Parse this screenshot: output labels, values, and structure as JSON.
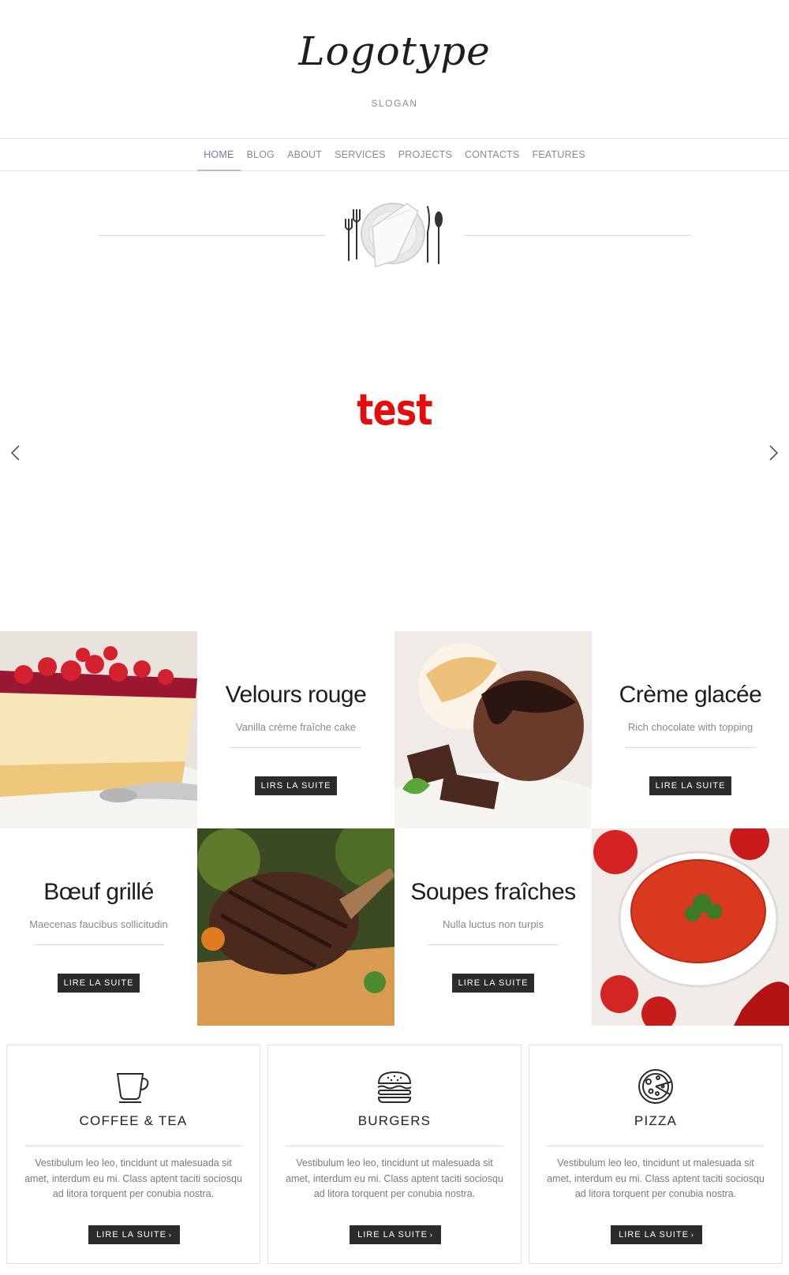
{
  "header": {
    "logo": "Logotype",
    "slogan": "SLOGAN"
  },
  "nav": {
    "items": [
      {
        "label": "HOME",
        "active": true
      },
      {
        "label": "BLOG"
      },
      {
        "label": "ABOUT"
      },
      {
        "label": "SERVICES"
      },
      {
        "label": "PROJECTS"
      },
      {
        "label": "CONTACTS"
      },
      {
        "label": "FEATURES"
      }
    ]
  },
  "slider": {
    "text": "test",
    "text_color": "#e30d0d",
    "prev_icon": "chevron-left-icon",
    "next_icon": "chevron-right-icon"
  },
  "tiles": [
    {
      "title": "Velours rouge",
      "subtitle": "Vanilla crème fraîche cake",
      "button": "LIRS LA SUITE"
    },
    {
      "title": "Crème glacée",
      "subtitle": "Rich chocolate with topping",
      "button": "LIRE LA SUITE"
    },
    {
      "title": "Bœuf grillé",
      "subtitle": "Maecenas faucibus sollicitudin",
      "button": "LIRE LA SUITE"
    },
    {
      "title": "Soupes fraîches",
      "subtitle": "Nulla luctus non turpis",
      "button": "LIRE LA SUITE"
    }
  ],
  "cards": [
    {
      "icon": "coffee-cup-icon",
      "title": "COFFEE & TEA",
      "text": "Vestibulum leo leo, tincidunt ut malesuada sit amet, interdum eu mi. Class aptent taciti sociosqu ad litora torquent per conubia nostra.",
      "button": "LIRE LA SUITE"
    },
    {
      "icon": "burger-icon",
      "title": "BURGERS",
      "text": "Vestibulum leo leo, tincidunt ut malesuada sit amet, interdum eu mi. Class aptent taciti sociosqu ad litora torquent per conubia nostra.",
      "button": "LIRE LA SUITE"
    },
    {
      "icon": "pizza-icon",
      "title": "PIZZA",
      "text": "Vestibulum leo leo, tincidunt ut malesuada sit amet, interdum eu mi. Class aptent taciti sociosqu ad litora torquent per conubia nostra.",
      "button": "LIRE LA SUITE"
    }
  ],
  "colors": {
    "button_bg": "#2b2b2b",
    "nav_active": "#7b76a8",
    "nav_underline": "#bdb9de"
  }
}
